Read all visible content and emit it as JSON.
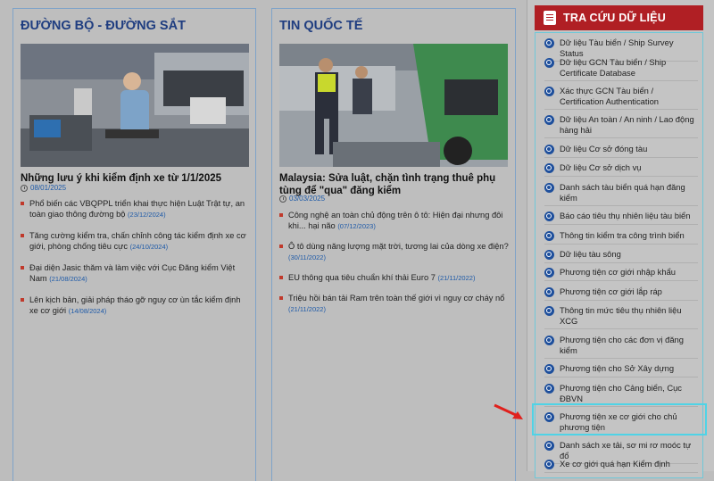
{
  "columns": [
    {
      "title": "ĐƯỜNG BỘ - ĐƯỜNG SẮT",
      "headline": "Những lưu ý khi kiểm định xe từ 1/1/2025",
      "date": "08/01/2025",
      "news": [
        {
          "text": "Phổ biến các VBQPPL triển khai thực hiện Luật Trật tự, an toàn giao thông đường bộ",
          "date": "(23/12/2024)"
        },
        {
          "text": "Tăng cường kiểm tra, chấn chỉnh công tác kiểm định xe cơ giới, phòng chống tiêu cực",
          "date": "(24/10/2024)"
        },
        {
          "text": "Đại diện Jasic thăm và làm việc với Cục Đăng kiểm Việt Nam",
          "date": "(21/08/2024)"
        },
        {
          "text": "Lên kịch bản, giải pháp tháo gỡ nguy cơ ùn tắc kiểm định xe cơ giới",
          "date": "(14/08/2024)"
        }
      ]
    },
    {
      "title": "TIN QUỐC TẾ",
      "headline": "Malaysia: Sửa luật, chặn tình trạng thuê phụ tùng để \"qua\" đăng kiểm",
      "date": "03/03/2025",
      "news": [
        {
          "text": "Công nghệ an toàn chủ động trên ô tô: Hiện đại nhưng đôi khi... hại não",
          "date": "(07/12/2023)"
        },
        {
          "text": "Ô tô dùng năng lượng mặt trời, tương lai của dòng xe điện?",
          "date": "(30/11/2022)"
        },
        {
          "text": "EU thông qua tiêu chuẩn khí thải Euro 7",
          "date": "(21/11/2022)"
        },
        {
          "text": "Triệu hồi bán tải Ram trên toàn thế giới vì nguy cơ cháy nổ",
          "date": "(21/11/2022)"
        }
      ]
    }
  ],
  "sidebar": {
    "title": "TRA CỨU DỮ LIỆU",
    "items": [
      {
        "label": "Dữ liệu Tàu biển / Ship Survey Status"
      },
      {
        "label": "Dữ liệu GCN Tàu biển / Ship Certificate Database"
      },
      {
        "label": "Xác thực GCN Tàu biển / Certification Authentication"
      },
      {
        "label": "Dữ liệu An toàn / An ninh / Lao động hàng hải"
      },
      {
        "label": "Dữ liệu Cơ sở đóng tàu"
      },
      {
        "label": "Dữ liệu Cơ sở dịch vụ"
      },
      {
        "label": "Danh sách tàu biển quá hạn đăng kiểm"
      },
      {
        "label": "Báo cáo tiêu thụ nhiên liệu tàu biển"
      },
      {
        "label": "Thông tin kiểm tra công trình biển"
      },
      {
        "label": "Dữ liệu tàu sông"
      },
      {
        "label": "Phương tiện cơ giới nhập khẩu"
      },
      {
        "label": "Phương tiện cơ giới lắp ráp"
      },
      {
        "label": "Thông tin mức tiêu thụ nhiên liệu XCG"
      },
      {
        "label": "Phương tiện cho các đơn vị đăng kiểm"
      },
      {
        "label": "Phương tiện cho Sở Xây dựng"
      },
      {
        "label": "Phương tiện cho Cảng biển, Cục ĐBVN"
      },
      {
        "label": "Phương tiện xe cơ giới cho chủ phương tiện"
      },
      {
        "label": "Danh sách xe tải, sơ mi rơ moóc tự đổ"
      },
      {
        "label": "Xe cơ giới quá hạn Kiểm định"
      }
    ]
  },
  "colors": {
    "accent_red": "#b01f24",
    "link_blue": "#1e4f9c",
    "highlight": "#4fd3e6"
  }
}
